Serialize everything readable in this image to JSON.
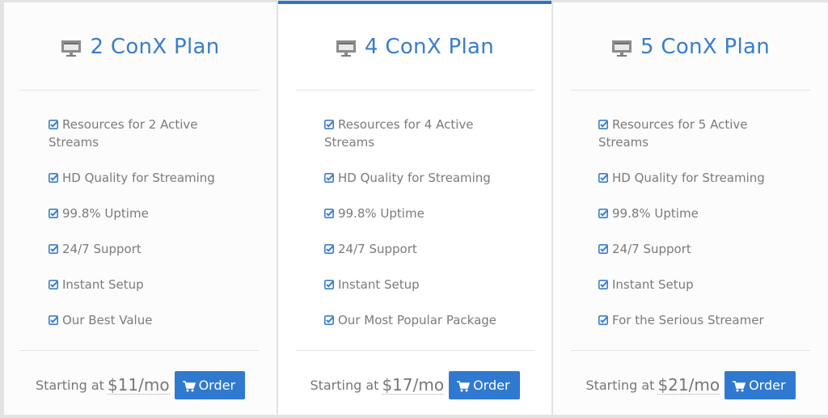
{
  "colors": {
    "accent": "#2f7ad0",
    "title": "#3a7dcc",
    "text": "#7b7b7b",
    "featured_top_border": "#2f73c8"
  },
  "plans": [
    {
      "title": "2 ConX Plan",
      "icon": "monitor-icon",
      "featured": false,
      "features": [
        "Resources for 2 Active Streams",
        "HD Quality for Streaming",
        "99.8% Uptime",
        "24/7 Support",
        "Instant Setup",
        "Our Best Value"
      ],
      "starting_label": "Starting at",
      "price": "$11/mo",
      "order_label": "Order"
    },
    {
      "title": "4 ConX Plan",
      "icon": "monitor-icon",
      "featured": true,
      "features": [
        "Resources for 4 Active Streams",
        "HD Quality for Streaming",
        "99.8% Uptime",
        "24/7 Support",
        "Instant Setup",
        "Our Most Popular Package"
      ],
      "starting_label": "Starting at",
      "price": "$17/mo",
      "order_label": "Order"
    },
    {
      "title": "5 ConX Plan",
      "icon": "monitor-icon",
      "featured": false,
      "features": [
        "Resources for 5 Active Streams",
        "HD Quality for Streaming",
        "99.8% Uptime",
        "24/7 Support",
        "Instant Setup",
        "For the Serious Streamer"
      ],
      "starting_label": "Starting at",
      "price": "$21/mo",
      "order_label": "Order"
    }
  ]
}
